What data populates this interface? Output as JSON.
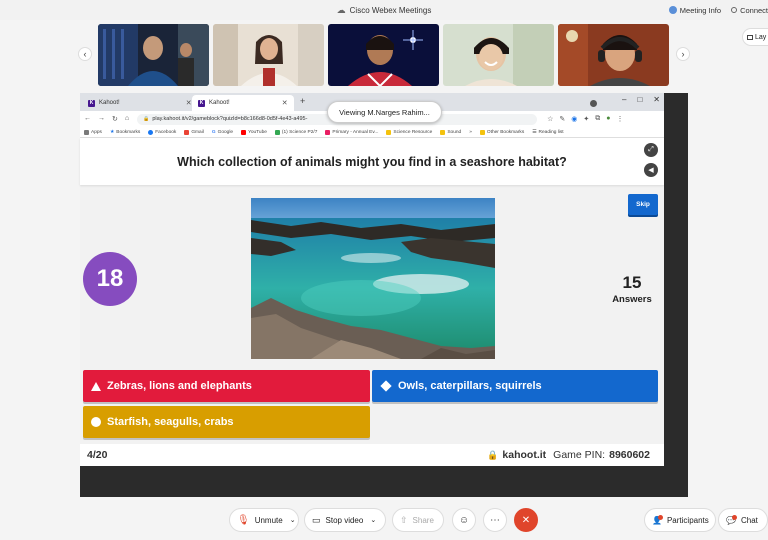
{
  "window": {
    "title": "Cisco Webex Meetings",
    "meeting_info": "Meeting Info",
    "connect": "Connect"
  },
  "strip": {
    "layout_label": "Lay"
  },
  "browser": {
    "tabs": [
      {
        "label": "Kahoot!"
      },
      {
        "label": "Kahoot!"
      }
    ],
    "url": "play.kahoot.it/v2/gameblock?quizId=b8c166d8-0d5f-4e43-a495-",
    "bookmarks": [
      "Apps",
      "Bookmarks",
      "Facebook",
      "Gmail",
      "Google",
      "YouTube",
      "(1) Science P2/7",
      "Primary - Annual Ev...",
      "Science Resource",
      "Sound",
      "Other Bookmarks",
      "Reading list"
    ]
  },
  "viewing": "Viewing M.Narges Rahim...",
  "kahoot": {
    "question": "Which collection of animals might you find in a seashore habitat?",
    "timer": "18",
    "answers_count": "15",
    "answers_label": "Answers",
    "skip_label": "Skip",
    "options": [
      {
        "text": "Zebras, lions and elephants",
        "color": "#e21b3c",
        "shape": "triangle"
      },
      {
        "text": "Owls, caterpillars, squirrels",
        "color": "#1368ce",
        "shape": "diamond"
      },
      {
        "text": "Starfish, seagulls, crabs",
        "color": "#d89e00",
        "shape": "circle"
      }
    ],
    "progress": "4/20",
    "brand": "kahoot.it",
    "pin_label": "Game PIN:",
    "pin": "8960602"
  },
  "toolbar": {
    "unmute": "Unmute",
    "stop_video": "Stop video",
    "share": "Share",
    "participants": "Participants",
    "chat": "Chat"
  }
}
